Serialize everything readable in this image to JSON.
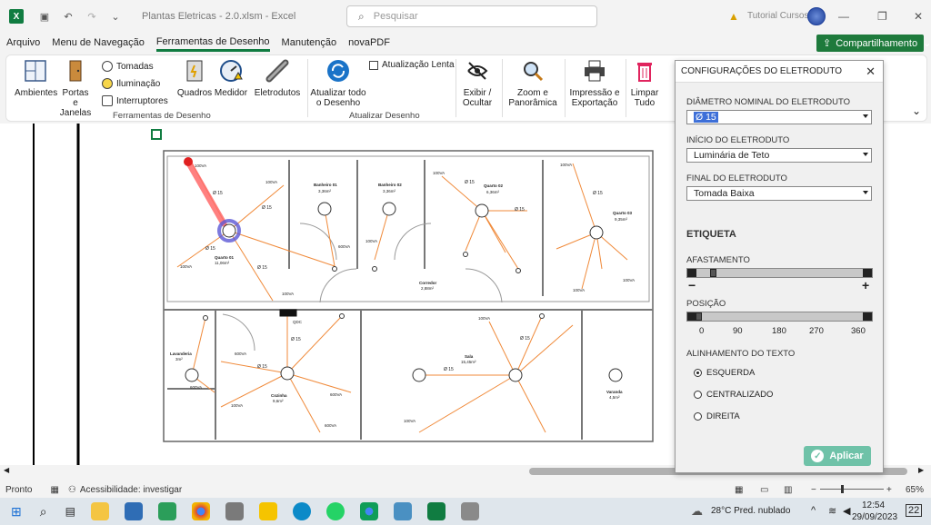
{
  "app": {
    "title": "Plantas Eletricas - 2.0.xlsm  -  Excel",
    "search_placeholder": "Pesquisar",
    "user": "Tutorial Cursos"
  },
  "menu": {
    "tabs": [
      "Arquivo",
      "Menu de Navegação",
      "Ferramentas de Desenho",
      "Manutenção",
      "novaPDF"
    ],
    "active_tab": "Ferramentas de Desenho",
    "share_label": "Compartilhamento"
  },
  "ribbon": {
    "ambientes": "Ambientes",
    "portas_l1": "Portas e",
    "portas_l2": "Janelas",
    "tomadas": "Tomadas",
    "iluminacao": "Iluminação",
    "interruptores": "Interruptores",
    "quadros": "Quadros",
    "medidor": "Medidor",
    "eletrodutos": "Eletrodutos",
    "group_desenho": "Ferramentas de Desenho",
    "atualizar_l1": "Atualizar todo",
    "atualizar_l2": "o Desenho",
    "atualizacao_lenta": "Atualização Lenta",
    "group_atualizar": "Atualizar Desenho",
    "exibir_l1": "Exibir /",
    "exibir_l2": "Ocultar",
    "zoom_l1": "Zoom e",
    "zoom_l2": "Panorâmica",
    "impressao_l1": "Impressão e",
    "impressao_l2": "Exportação",
    "limpar_l1": "Limpar",
    "limpar_l2": "Tudo"
  },
  "floorplan": {
    "rooms": [
      {
        "name": "Banheiro 01",
        "area": "3,36m²"
      },
      {
        "name": "Banheiro 02",
        "area": "3,36m²"
      },
      {
        "name": "Quarto 02",
        "area": "6,36m²"
      },
      {
        "name": "Quarto 03",
        "area": "9,35m²"
      },
      {
        "name": "Quarto 01",
        "area": "11,06m²"
      },
      {
        "name": "Corredor",
        "area": "2,88m²"
      },
      {
        "name": "Lavanderia",
        "area": "3m²"
      },
      {
        "name": "Cozinha",
        "area": "9,6m²"
      },
      {
        "name": "Sala",
        "area": "15,45m²"
      },
      {
        "name": "Varanda",
        "area": "4,5m²"
      }
    ],
    "conduit_label": "Ø 15",
    "outlet_label": "100VA",
    "outlet_label_600": "600VA",
    "qdc": "QDC"
  },
  "panel": {
    "title": "CONFIGURAÇÕES DO ELETRODUTO",
    "diametro_label": "DIÂMETRO NOMINAL DO ELETRODUTO",
    "diametro_value": "Ø 15",
    "inicio_label": "INÍCIO DO ELETRODUTO",
    "inicio_value": "Luminária de Teto",
    "final_label": "FINAL DO ELETRODUTO",
    "final_value": "Tomada Baixa",
    "etiqueta": "ETIQUETA",
    "afastamento": "AFASTAMENTO",
    "minus": "−",
    "plus": "+",
    "posicao": "POSIÇÃO",
    "pos_ticks": [
      "0",
      "90",
      "180",
      "270",
      "360"
    ],
    "alinhamento": "ALINHAMENTO DO TEXTO",
    "options": [
      "ESQUERDA",
      "CENTRALIZADO",
      "DIREITA"
    ],
    "selected_option": "ESQUERDA",
    "apply": "Aplicar"
  },
  "status": {
    "ready": "Pronto",
    "accessibility": "Acessibilidade: investigar",
    "zoom": "65%"
  },
  "taskbar": {
    "weather": "28°C  Pred. nublado",
    "time": "12:54",
    "date": "29/09/2023",
    "badge": "22"
  }
}
